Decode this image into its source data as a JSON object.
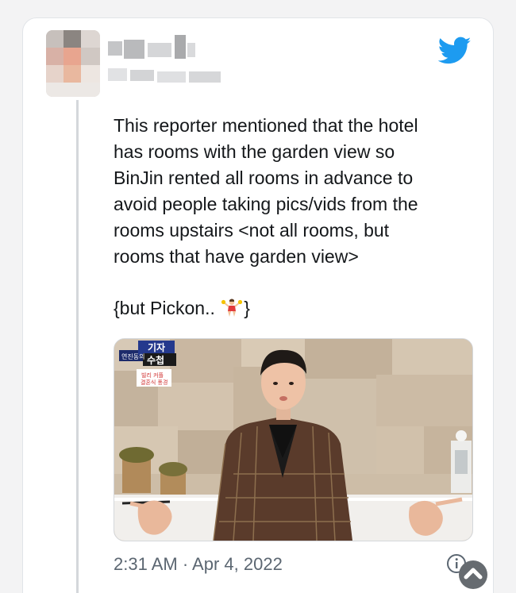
{
  "tweet": {
    "author_name": "",
    "author_handle": "",
    "body": "This reporter mentioned that the hotel\nhas rooms with the garden view so\nBinJin rented all rooms in advance to\navoid people taking pics/vids from the\nrooms upstairs <not all rooms, but\nrooms that have garden view>",
    "reply_prefix": "{but Pickon..",
    "reply_suffix": "}",
    "reply_emoji": "cheerleader-emoji",
    "timestamp": "2:31 AM · Apr 4, 2022"
  },
  "media": {
    "logo_top": "기자",
    "logo_left": "연진동의",
    "logo_right": "수첩",
    "caption_line1": "빌리 커플",
    "caption_line2": "결혼식 풍경"
  },
  "icons": {
    "brand": "twitter-bird-icon",
    "info": "info-icon",
    "scroll": "scroll-up-icon"
  },
  "colors": {
    "twitter_blue": "#1d9bf0",
    "text": "#14171a",
    "muted": "#5b6671",
    "thread_line": "#d4d7db"
  }
}
